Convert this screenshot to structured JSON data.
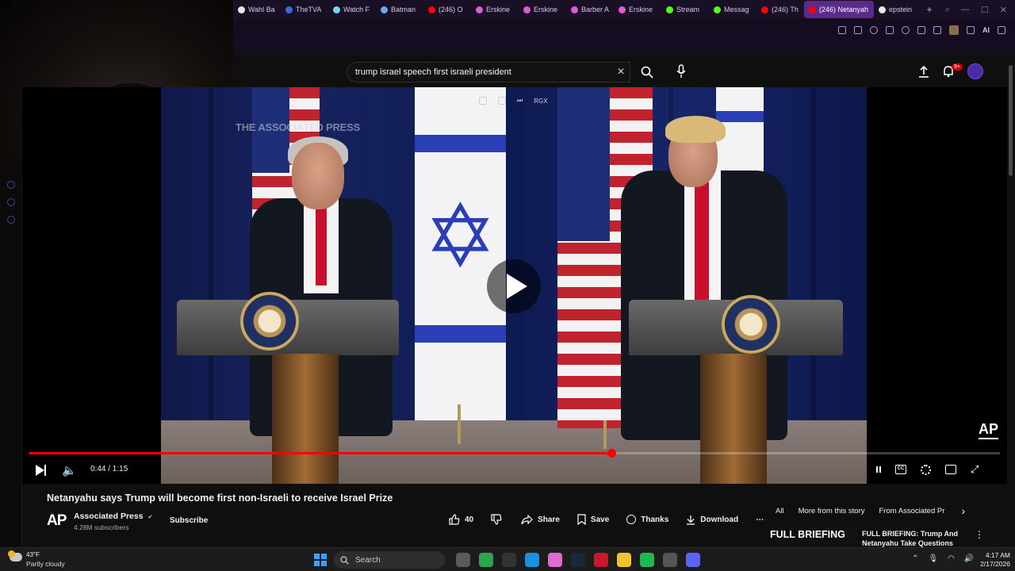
{
  "browser": {
    "tabs": [
      {
        "title": "Wahl Ba",
        "color": "#e8e8e8"
      },
      {
        "title": "TheTVA",
        "color": "#3b6cd9"
      },
      {
        "title": "Watch F",
        "color": "#7ad6f0"
      },
      {
        "title": "Batman",
        "color": "#6ea8e8"
      },
      {
        "title": "(246) O",
        "color": "#ff0000"
      },
      {
        "title": "Erskine",
        "color": "#e05ad6"
      },
      {
        "title": "Erskine",
        "color": "#e05ad6"
      },
      {
        "title": "Barber A",
        "color": "#e05ad6"
      },
      {
        "title": "Erskine",
        "color": "#e05ad6"
      },
      {
        "title": "Stream",
        "color": "#53fc18"
      },
      {
        "title": "Messag",
        "color": "#53fc18"
      },
      {
        "title": "(246) Th",
        "color": "#ff0000"
      },
      {
        "title": "(246) Netanyah",
        "color": "#ff0000",
        "active": true
      },
      {
        "title": "epstein",
        "color": "#e8e8e8"
      }
    ],
    "new_tab": "+",
    "toolbar_ai": "AI"
  },
  "youtube": {
    "search_query": "trump israel speech first israeli president",
    "notification_count": "9+"
  },
  "video": {
    "watermark": "THE ASSOCIATED PRESS",
    "corner_logo": "AP",
    "overlay_label": "RGX",
    "current_time": "0:44",
    "duration": "1:15",
    "time_display": "0:44 / 1:15",
    "progress": 0.6,
    "cc_label": "CC"
  },
  "meta": {
    "title": "Netanyahu says Trump will become first non-Israeli to receive Israel Prize",
    "channel_logo": "AP",
    "channel_name": "Associated Press",
    "verified": "✔",
    "subscribers": "4.28M subscribers",
    "subscribe_label": "Subscribe",
    "likes": "40",
    "share_label": "Share",
    "save_label": "Save",
    "thanks_label": "Thanks",
    "download_label": "Download",
    "more": "⋯"
  },
  "sidebar": {
    "chips": [
      "All",
      "More from this story",
      "From Associated Pr"
    ],
    "rec_thumb_text": "FULL BRIEFING",
    "rec_title": "FULL BRIEFING: Trump And Netanyahu Take Questions"
  },
  "taskbar": {
    "temperature": "43°F",
    "condition": "Partly cloudy",
    "search_label": "Search",
    "time": "4:17 AM",
    "date": "2/17/2026",
    "apps": [
      {
        "name": "task-view",
        "color": "#5a5a5a"
      },
      {
        "name": "app-green",
        "color": "#2ea44f"
      },
      {
        "name": "app-epic",
        "color": "#333"
      },
      {
        "name": "edge",
        "color": "#1b8fe0"
      },
      {
        "name": "copilot",
        "color": "#e06ad0"
      },
      {
        "name": "steam",
        "color": "#1b2838"
      },
      {
        "name": "opera",
        "color": "#c9182d"
      },
      {
        "name": "files",
        "color": "#f2c230"
      },
      {
        "name": "spotify",
        "color": "#1db954"
      },
      {
        "name": "chrome-like",
        "color": "#555"
      },
      {
        "name": "discord",
        "color": "#5865f2"
      }
    ]
  },
  "colors": {
    "progress_red": "#ff0000",
    "browser_accent": "#5b2a8c"
  }
}
